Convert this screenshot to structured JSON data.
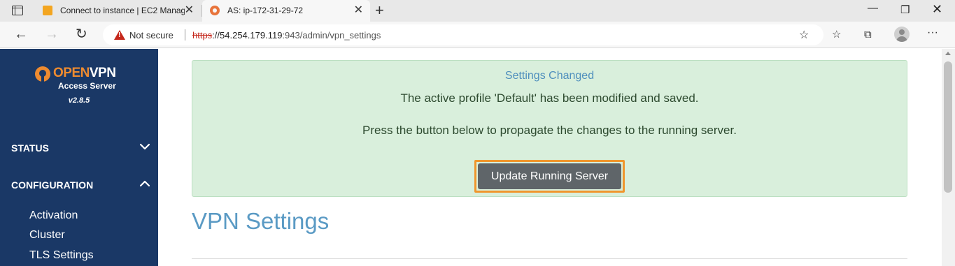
{
  "browser": {
    "tabs": [
      {
        "title": "Connect to instance | EC2 Manag",
        "icon": "aws-icon",
        "active": false
      },
      {
        "title": "AS: ip-172-31-29-72",
        "icon": "openvpn-icon",
        "active": true
      }
    ],
    "close_glyph": "✕",
    "new_tab_glyph": "+",
    "address": {
      "security_label": "Not secure",
      "scheme": "https",
      "host": "://54.254.179.119",
      "rest": ":943/admin/vpn_settings"
    }
  },
  "sidebar": {
    "logo_open": "OPEN",
    "logo_vpn": "VPN",
    "logo_sub": "Access Server",
    "version": "v2.8.5",
    "sections": [
      {
        "label": "STATUS",
        "expanded": false
      },
      {
        "label": "CONFIGURATION",
        "expanded": true
      }
    ],
    "items": [
      "Activation",
      "Cluster",
      "TLS Settings"
    ]
  },
  "alert": {
    "title": "Settings Changed",
    "message1": "The active profile 'Default' has been modified and saved.",
    "message2": "Press the button below to propagate the changes to the running server.",
    "button_label": "Update Running Server"
  },
  "main": {
    "page_title": "VPN Settings"
  },
  "colors": {
    "sidebar_bg": "#1a3866",
    "brand_orange": "#ee8b30",
    "alert_bg": "#d9efdc",
    "title_blue": "#5a9ac4",
    "highlight_border": "#f0962d"
  }
}
